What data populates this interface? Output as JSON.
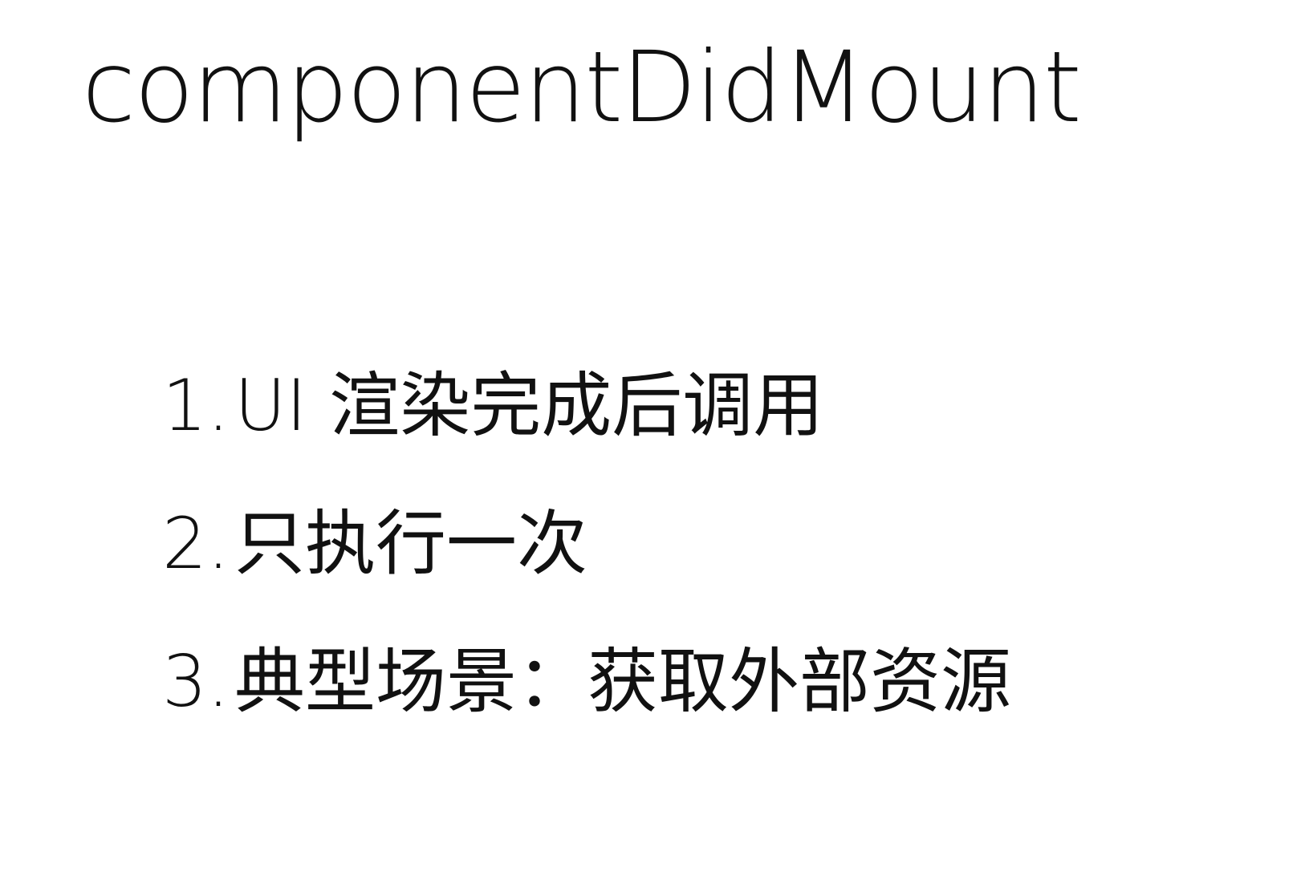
{
  "slide": {
    "title": "componentDidMount",
    "points": [
      {
        "number": "1.",
        "text": "UI 渲染完成后调用"
      },
      {
        "number": "2.",
        "text": "只执行一次"
      },
      {
        "number": "3.",
        "text": "典型场景：获取外部资源"
      }
    ]
  }
}
